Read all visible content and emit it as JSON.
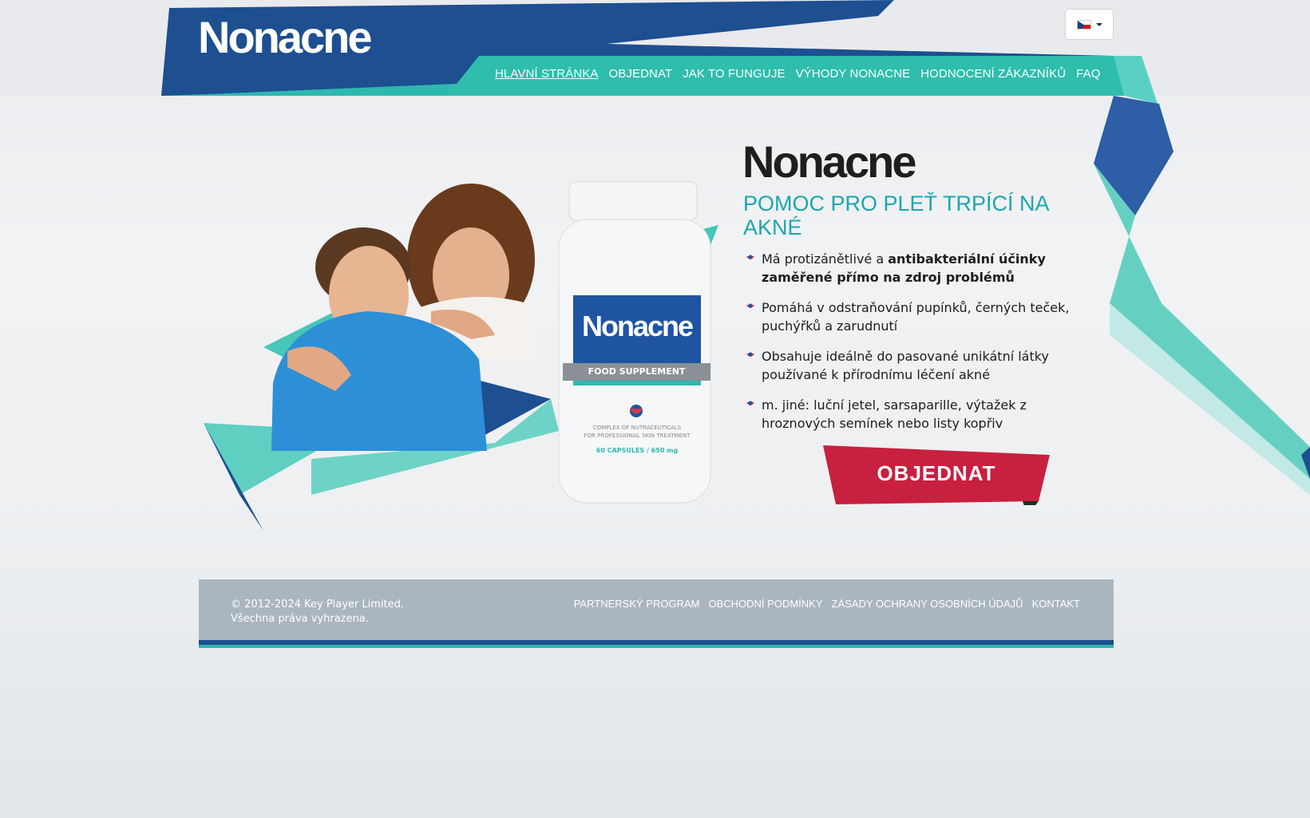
{
  "header": {
    "logo_text": "Nonacne",
    "language": {
      "selected": "CZ",
      "flag": "czech-flag-icon"
    },
    "nav": [
      {
        "label": "HLAVNÍ STRÁNKA",
        "active": true
      },
      {
        "label": "OBJEDNAT",
        "active": false
      },
      {
        "label": "JAK TO FUNGUJE",
        "active": false
      },
      {
        "label": "VÝHODY NONACNE",
        "active": false
      },
      {
        "label": "HODNOCENÍ ZÁKAZNÍKŮ",
        "active": false
      },
      {
        "label": "FAQ",
        "active": false
      }
    ]
  },
  "hero": {
    "brand": "Nonacne",
    "tagline": "POMOC PRO PLEŤ TRPÍCÍ NA AKNÉ",
    "product": {
      "label": "Nonacne",
      "band": "FOOD SUPPLEMENT",
      "desc_line1": "COMPLEX OF NUTRACEUTICALS",
      "desc_line2": "FOR PROFESSIONAL SKIN TREATMENT",
      "capsules": "60 CAPSULES / 650 mg"
    },
    "features": [
      {
        "text": "Má protizánětlivé a ",
        "bold": "antibakteriální účinky zaměřené přímo na zdroj problémů"
      },
      {
        "text": "Pomáhá v odstraňování pupínků, černých teček, puchýřků a zarudnutí",
        "bold": ""
      },
      {
        "text": "Obsahuje ideálně do pasované unikátní látky používané k přírodnímu léčení akné",
        "bold": ""
      },
      {
        "text": "m. jiné: luční jetel, sarsaparille, výtažek z hroznových semínek nebo listy kopřiv",
        "bold": ""
      }
    ],
    "order_button": "OBJEDNAT"
  },
  "footer": {
    "copyright_line1": "© 2012-2024 Key Player Limited.",
    "copyright_line2": "Všechna práva vyhrazena.",
    "links": [
      "PARTNERSKÝ PROGRAM",
      "OBCHODNÍ PODMÍNKY",
      "ZÁSADY OCHRANY OSOBNÍCH ÚDAJŮ",
      "KONTAKT"
    ]
  },
  "colors": {
    "navy": "#1d4f91",
    "teal": "#2fb8b0",
    "accent_text": "#1ba7b0",
    "button_red": "#c8203f",
    "footer_gray": "#a9b6bf"
  }
}
